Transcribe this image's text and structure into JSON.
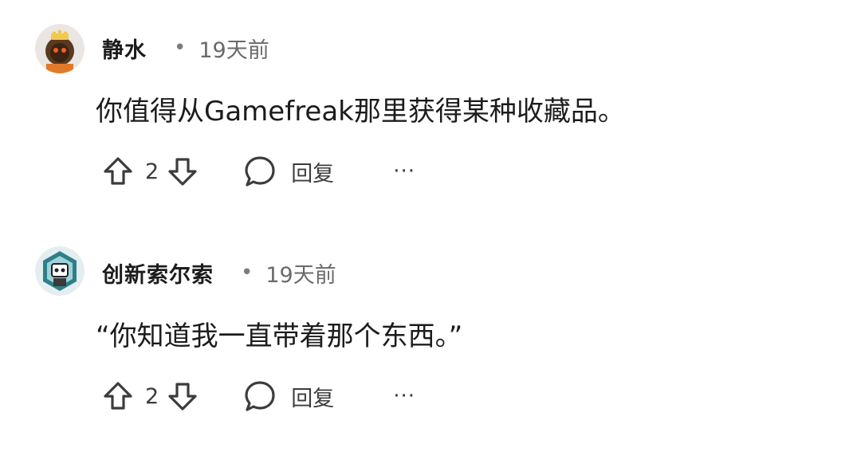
{
  "comments": [
    {
      "username": "静水",
      "separator": "•",
      "time": "19天前",
      "text": "你值得从Gamefreak那里获得某种收藏品。",
      "votes": "2",
      "reply_label": "回复",
      "more": "···"
    },
    {
      "username": "创新索尔索",
      "separator": "•",
      "time": "19天前",
      "text": "“你知道我一直带着那个东西。”",
      "votes": "2",
      "reply_label": "回复",
      "more": "···"
    }
  ],
  "icons": {
    "upvote": "arrow-up-icon",
    "downvote": "arrow-down-icon",
    "reply": "speech-bubble-icon",
    "more": "ellipsis-icon"
  }
}
